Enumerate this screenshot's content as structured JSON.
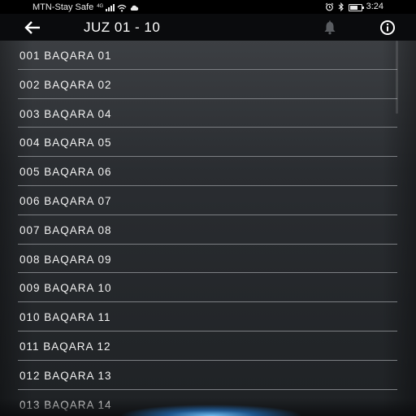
{
  "status_bar": {
    "carrier": "MTN-Stay Safe",
    "network_type": "4G",
    "time": "3:24",
    "battery_level": 0.75,
    "icons": [
      "signal-icon",
      "wifi-icon",
      "cloud-icon",
      "alarm-icon",
      "bluetooth-icon",
      "battery-icon"
    ]
  },
  "app_bar": {
    "title": "JUZ 01 - 10",
    "back_icon": "back-arrow-icon",
    "bell_icon": "bell-icon",
    "info_icon": "info-icon"
  },
  "list": {
    "items": [
      {
        "label": "001 BAQARA 01"
      },
      {
        "label": "002 BAQARA 02"
      },
      {
        "label": "003 BAQARA 04"
      },
      {
        "label": "004 BAQARA 05"
      },
      {
        "label": "005 BAQARA 06"
      },
      {
        "label": "006 BAQARA 07"
      },
      {
        "label": "007 BAQARA 08"
      },
      {
        "label": "008 BAQARA 09"
      },
      {
        "label": "009 BAQARA 10"
      },
      {
        "label": "010 BAQARA 11"
      },
      {
        "label": "011 BAQARA 12"
      },
      {
        "label": "012 BAQARA 13"
      },
      {
        "label": "013 BAQARA 14"
      }
    ]
  },
  "colors": {
    "app_bar_bg": "#0a0b0d",
    "list_bg": "#2a2d31",
    "divider": "#7c7f83",
    "text": "#f2f2f2",
    "accent_glow": "#3fa0ff"
  }
}
